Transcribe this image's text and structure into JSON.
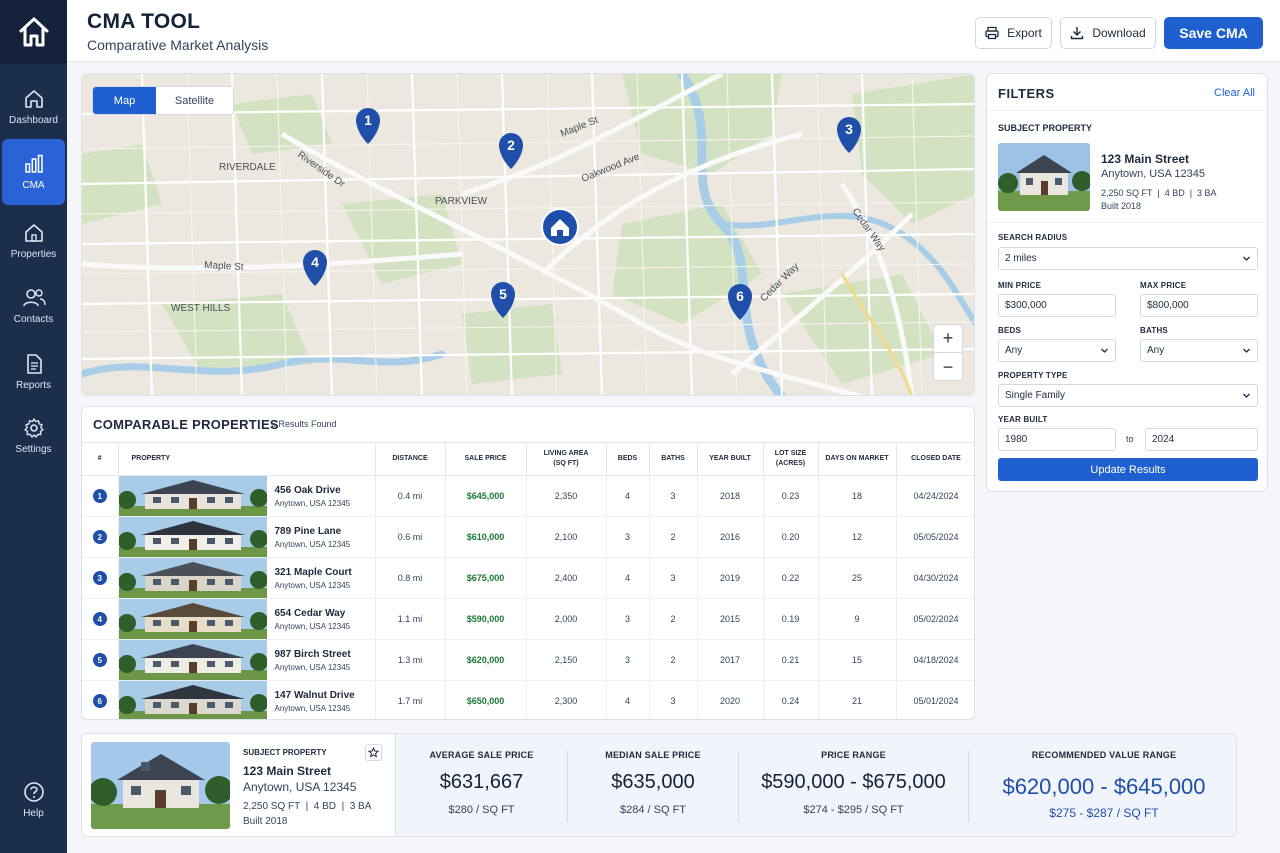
{
  "app": {
    "title": "CMA TOOL",
    "subtitle": "Comparative Market Analysis"
  },
  "header_actions": {
    "export": "Export",
    "download": "Download",
    "save": "Save CMA"
  },
  "sidebar": {
    "items": [
      {
        "label": "Dashboard",
        "icon": "home-icon"
      },
      {
        "label": "CMA",
        "icon": "bar-chart-icon",
        "active": true
      },
      {
        "label": "Properties",
        "icon": "house-icon"
      },
      {
        "label": "Contacts",
        "icon": "users-icon"
      },
      {
        "label": "Reports",
        "icon": "document-icon"
      },
      {
        "label": "Settings",
        "icon": "gear-icon"
      }
    ],
    "help": "Help"
  },
  "map": {
    "toggle": {
      "map": "Map",
      "satellite": "Satellite"
    },
    "labels": {
      "riverdale": "RIVERDALE",
      "parkview": "PARKVIEW",
      "west_hills": "WEST HILLS",
      "maple_st": "Maple St",
      "oakwood_ave": "Oakwood Ave",
      "riverside_dr": "Riverside Dr",
      "cedar_way": "Cedar Way",
      "cedar_way_2": "Cedar Way",
      "maple_st_2": "Maple St"
    },
    "pins": [
      "1",
      "2",
      "3",
      "4",
      "5",
      "6"
    ],
    "zoom": {
      "in": "+",
      "out": "−"
    }
  },
  "filters": {
    "title": "FILTERS",
    "clear": "Clear All",
    "subject_label": "SUBJECT PROPERTY",
    "subject": {
      "name": "123 Main Street",
      "city": "Anytown, USA 12345",
      "meta": "2,250 SQ FT  |  4 BD  |  3 BA",
      "built": "Built 2018"
    },
    "radius_label": "SEARCH RADIUS",
    "radius": "2 miles",
    "min_price_label": "MIN PRICE",
    "min_price": "$300,000",
    "max_price_label": "MAX PRICE",
    "max_price": "$800,000",
    "beds_label": "BEDS",
    "beds": "Any",
    "baths_label": "BATHS",
    "baths": "Any",
    "type_label": "PROPERTY TYPE",
    "type": "Single Family",
    "year_label": "YEAR BUILT",
    "year_from": "1980",
    "year_to_sep": "to",
    "year_to": "2024",
    "update": "Update Results"
  },
  "comps": {
    "title": "COMPARABLE PROPERTIES",
    "count": "6 Results Found",
    "columns": {
      "num": "#",
      "property": "PROPERTY",
      "distance": "DISTANCE",
      "price": "SALE PRICE",
      "area": "LIVING AREA",
      "area_unit": "(SQ FT)",
      "beds": "BEDS",
      "baths": "BATHS",
      "year": "YEAR BUILT",
      "lot": "LOT SIZE",
      "lot_unit": "(ACRES)",
      "dom": "DAYS ON MARKET",
      "closed": "CLOSED DATE"
    },
    "rows": [
      {
        "num": "1",
        "name": "456 Oak Drive",
        "city": "Anytown, USA 12345",
        "distance": "0.4 mi",
        "price": "$645,000",
        "area": "2,350",
        "beds": "4",
        "baths": "3",
        "year": "2018",
        "lot": "0.23",
        "dom": "18",
        "closed": "04/24/2024"
      },
      {
        "num": "2",
        "name": "789 Pine Lane",
        "city": "Anytown, USA 12345",
        "distance": "0.6 mi",
        "price": "$610,000",
        "area": "2,100",
        "beds": "3",
        "baths": "2",
        "year": "2016",
        "lot": "0.20",
        "dom": "12",
        "closed": "05/05/2024"
      },
      {
        "num": "3",
        "name": "321 Maple Court",
        "city": "Anytown, USA 12345",
        "distance": "0.8 mi",
        "price": "$675,000",
        "area": "2,400",
        "beds": "4",
        "baths": "3",
        "year": "2019",
        "lot": "0.22",
        "dom": "25",
        "closed": "04/30/2024"
      },
      {
        "num": "4",
        "name": "654 Cedar Way",
        "city": "Anytown, USA 12345",
        "distance": "1.1 mi",
        "price": "$590,000",
        "area": "2,000",
        "beds": "3",
        "baths": "2",
        "year": "2015",
        "lot": "0.19",
        "dom": "9",
        "closed": "05/02/2024"
      },
      {
        "num": "5",
        "name": "987 Birch Street",
        "city": "Anytown, USA 12345",
        "distance": "1.3 mi",
        "price": "$620,000",
        "area": "2,150",
        "beds": "3",
        "baths": "2",
        "year": "2017",
        "lot": "0.21",
        "dom": "15",
        "closed": "04/18/2024"
      },
      {
        "num": "6",
        "name": "147 Walnut Drive",
        "city": "Anytown, USA 12345",
        "distance": "1.7 mi",
        "price": "$650,000",
        "area": "2,300",
        "beds": "4",
        "baths": "3",
        "year": "2020",
        "lot": "0.24",
        "dom": "21",
        "closed": "05/01/2024"
      }
    ]
  },
  "summary": {
    "label": "SUBJECT PROPERTY",
    "name": "123 Main Street",
    "city": "Anytown, USA 12345",
    "meta": "2,250 SQ FT  |  4 BD  |  3 BA",
    "built": "Built 2018",
    "avg": {
      "label": "AVERAGE SALE PRICE",
      "value": "$631,667",
      "per": "$280 / SQ FT"
    },
    "median": {
      "label": "MEDIAN SALE PRICE",
      "value": "$635,000",
      "per": "$284 / SQ FT"
    },
    "range": {
      "label": "PRICE RANGE",
      "value": "$590,000 - $675,000",
      "per": "$274 - $295 / SQ FT"
    },
    "recommended": {
      "label": "RECOMMENDED VALUE RANGE",
      "value": "$620,000 - $645,000",
      "per": "$275 - $287 / SQ FT"
    }
  },
  "colors": {
    "sidebar": "#1b2e4b",
    "accent": "#1f5fd0",
    "price_green": "#1b7a35",
    "pin": "#1f4fa8"
  }
}
